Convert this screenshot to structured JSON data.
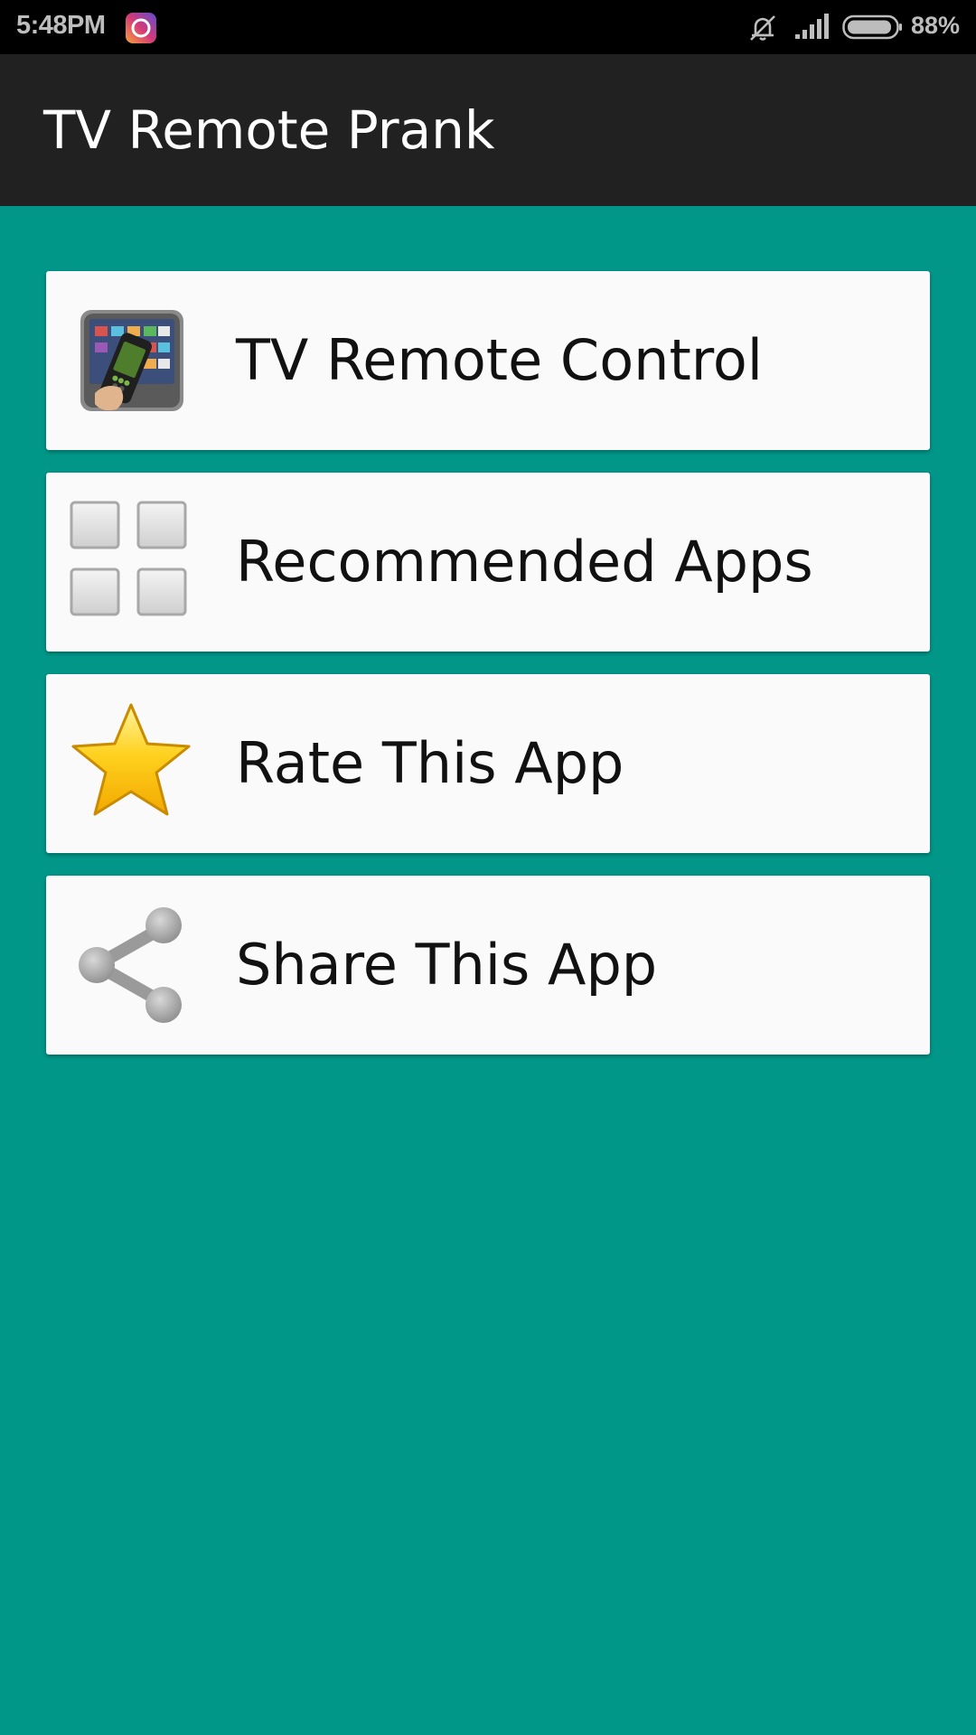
{
  "status_bar": {
    "time": "5:48PM",
    "battery_percent": "88%",
    "battery_level": 0.88,
    "icons": [
      "instagram-icon",
      "vibrate-mute-icon",
      "signal-icon",
      "battery-icon"
    ]
  },
  "app_bar": {
    "title": "TV Remote Prank",
    "background": "#212121"
  },
  "background_color": "#009688",
  "menu": {
    "items": [
      {
        "label": "TV Remote Control",
        "icon": "tv-remote-icon"
      },
      {
        "label": "Recommended Apps",
        "icon": "apps-grid-icon"
      },
      {
        "label": "Rate This App",
        "icon": "star-icon"
      },
      {
        "label": "Share This App",
        "icon": "share-icon"
      }
    ]
  }
}
